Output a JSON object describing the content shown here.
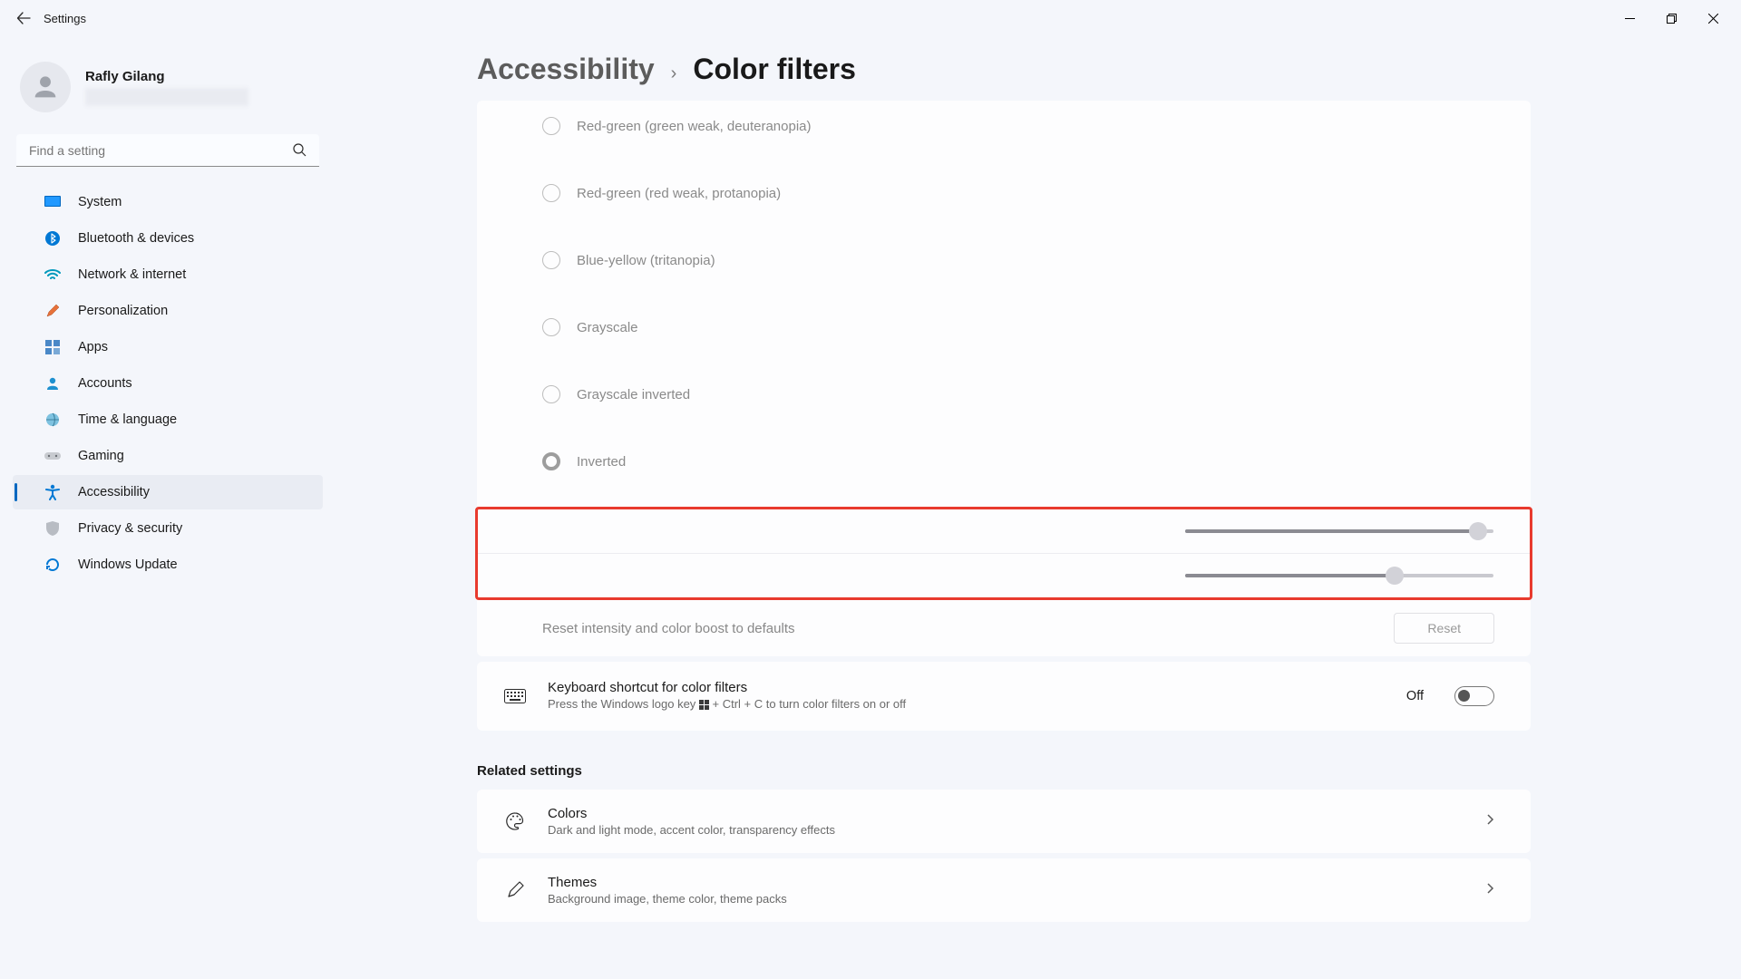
{
  "titlebar": {
    "label": "Settings"
  },
  "user": {
    "name": "Rafly Gilang"
  },
  "search": {
    "placeholder": "Find a setting"
  },
  "nav": {
    "items": [
      {
        "label": "System"
      },
      {
        "label": "Bluetooth & devices"
      },
      {
        "label": "Network & internet"
      },
      {
        "label": "Personalization"
      },
      {
        "label": "Apps"
      },
      {
        "label": "Accounts"
      },
      {
        "label": "Time & language"
      },
      {
        "label": "Gaming"
      },
      {
        "label": "Accessibility"
      },
      {
        "label": "Privacy & security"
      },
      {
        "label": "Windows Update"
      }
    ]
  },
  "breadcrumb": {
    "parent": "Accessibility",
    "current": "Color filters"
  },
  "filters": {
    "options": [
      {
        "label": "Red-green (green weak, deuteranopia)"
      },
      {
        "label": "Red-green (red weak, protanopia)"
      },
      {
        "label": "Blue-yellow (tritanopia)"
      },
      {
        "label": "Grayscale"
      },
      {
        "label": "Grayscale inverted"
      },
      {
        "label": "Inverted"
      }
    ]
  },
  "sliders": {
    "intensity_pct": 95,
    "boost_pct": 68
  },
  "reset": {
    "label": "Reset intensity and color boost to defaults",
    "button": "Reset"
  },
  "shortcut": {
    "title": "Keyboard shortcut for color filters",
    "desc_pre": "Press the Windows logo key ",
    "desc_post": " + Ctrl + C to turn color filters on or off",
    "state": "Off"
  },
  "related": {
    "heading": "Related settings",
    "items": [
      {
        "title": "Colors",
        "desc": "Dark and light mode, accent color, transparency effects"
      },
      {
        "title": "Themes",
        "desc": "Background image, theme color, theme packs"
      }
    ]
  }
}
